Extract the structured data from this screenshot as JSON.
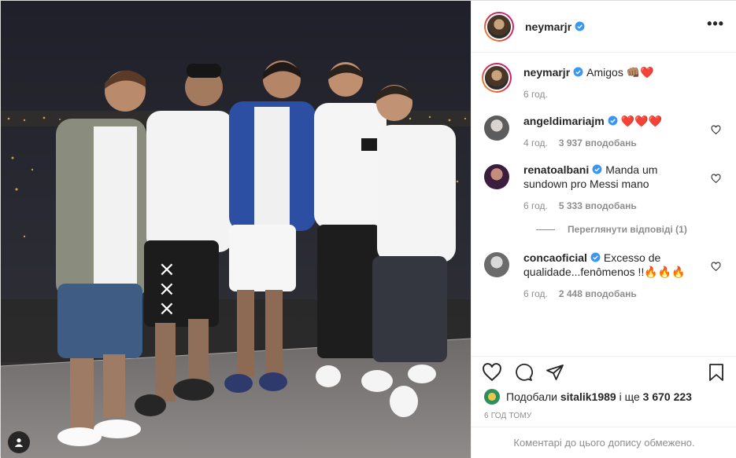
{
  "post": {
    "username": "neymarjr",
    "more_label": "•••",
    "tag_icon": "user-tag-icon"
  },
  "caption": {
    "username": "neymarjr",
    "text": "Amigos 👊🏽❤️",
    "time": "6 год."
  },
  "comments": [
    {
      "username": "angeldimariajm",
      "text": "❤️❤️❤️",
      "time": "4 год.",
      "likes": "3 937 вподобань",
      "verified": true
    },
    {
      "username": "renatoalbani",
      "text": "Manda um sundown pro Messi mano",
      "time": "6 год.",
      "likes": "5 333 вподобань",
      "verified": true
    },
    {
      "username": "concaoficial",
      "text": "Excesso de qualidade...fenômenos !!🔥🔥🔥",
      "time": "6 год.",
      "likes": "2 448 вподобань",
      "verified": true
    }
  ],
  "view_replies": "Переглянути відповіді (1)",
  "likes_row": {
    "prefix": "Подобали",
    "user": "sitalik1989",
    "middle": "і ще",
    "count": "3 670 223"
  },
  "timestamp": "6 ГОД ТОМУ",
  "comments_limited": "Коментарі до цього допису обмежено.",
  "colors": {
    "verified": "#3897f0",
    "muted": "#8e8e8e",
    "border": "#efefef",
    "text": "#262626"
  }
}
